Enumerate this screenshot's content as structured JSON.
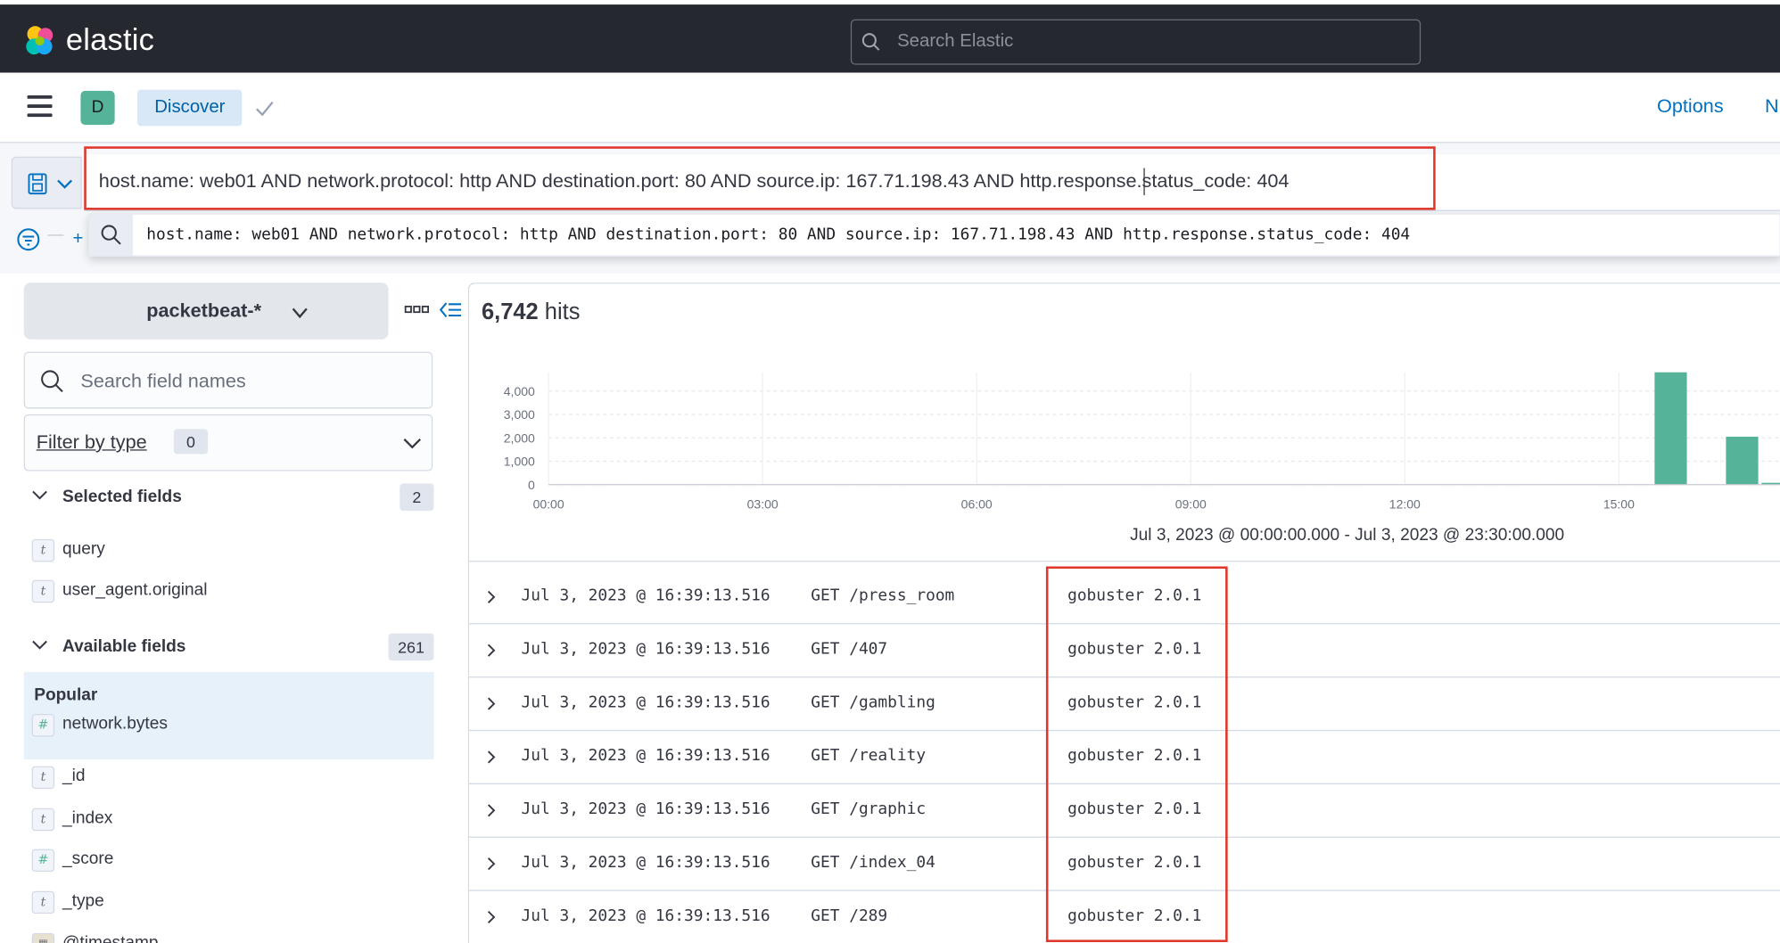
{
  "header": {
    "brand": "elastic",
    "search_placeholder": "Search Elastic"
  },
  "appbar": {
    "space_initial": "D",
    "breadcrumb": "Discover",
    "options": "Options",
    "new": "N"
  },
  "query_bar": {
    "query": "host.name: web01 AND network.protocol: http AND destination.port: 80 AND source.ip: 167.71.198.43 AND http.response.status_code: 404",
    "suggestion": "host.name: web01 AND network.protocol: http AND destination.port: 80 AND source.ip: 167.71.198.43 AND http.response.status_code: 404",
    "filter_plus": "+"
  },
  "sidebar": {
    "index_pattern": "packetbeat-*",
    "field_search_placeholder": "Search field names",
    "filter_by_type_label": "Filter by type",
    "filter_by_type_count": "0",
    "selected_fields_label": "Selected fields",
    "selected_fields_count": "2",
    "selected_fields": [
      {
        "type": "t",
        "name": "query"
      },
      {
        "type": "t",
        "name": "user_agent.original"
      }
    ],
    "available_fields_label": "Available fields",
    "available_fields_count": "261",
    "popular_label": "Popular",
    "popular_fields": [
      {
        "type": "#",
        "name": "network.bytes"
      }
    ],
    "available_fields": [
      {
        "type": "t",
        "name": "_id"
      },
      {
        "type": "t",
        "name": "_index"
      },
      {
        "type": "#",
        "name": "_score"
      },
      {
        "type": "t",
        "name": "_type"
      },
      {
        "type": "cal",
        "name": "@timestamp"
      }
    ]
  },
  "results": {
    "hits_count": "6,742",
    "hits_label": "hits",
    "time_range": "Jul 3, 2023 @ 00:00:00.000 - Jul 3, 2023 @ 23:30:00.000",
    "rows": [
      {
        "timestamp": "Jul 3, 2023 @ 16:39:13.516",
        "request": "GET /press_room",
        "user_agent": "gobuster 2.0.1"
      },
      {
        "timestamp": "Jul 3, 2023 @ 16:39:13.516",
        "request": "GET /407",
        "user_agent": "gobuster 2.0.1"
      },
      {
        "timestamp": "Jul 3, 2023 @ 16:39:13.516",
        "request": "GET /gambling",
        "user_agent": "gobuster 2.0.1"
      },
      {
        "timestamp": "Jul 3, 2023 @ 16:39:13.516",
        "request": "GET /reality",
        "user_agent": "gobuster 2.0.1"
      },
      {
        "timestamp": "Jul 3, 2023 @ 16:39:13.516",
        "request": "GET /graphic",
        "user_agent": "gobuster 2.0.1"
      },
      {
        "timestamp": "Jul 3, 2023 @ 16:39:13.516",
        "request": "GET /index_04",
        "user_agent": "gobuster 2.0.1"
      },
      {
        "timestamp": "Jul 3, 2023 @ 16:39:13.516",
        "request": "GET /289",
        "user_agent": "gobuster 2.0.1"
      }
    ]
  },
  "colors": {
    "header_bg": "#25282f",
    "accent": "#0071c2",
    "bar": "#54b399",
    "highlight": "#e0362a"
  },
  "chart_data": {
    "type": "bar",
    "x_ticks": [
      "00:00",
      "03:00",
      "06:00",
      "09:00",
      "12:00",
      "15:00"
    ],
    "y_ticks": [
      "4,000",
      "3,000",
      "2,000",
      "1,000",
      "0"
    ],
    "ylim": [
      0,
      4800
    ],
    "grid": true,
    "series": [
      {
        "x": [
          "16:00",
          "17:00",
          "17:30"
        ],
        "values": [
          4850,
          2050,
          80
        ]
      }
    ]
  }
}
